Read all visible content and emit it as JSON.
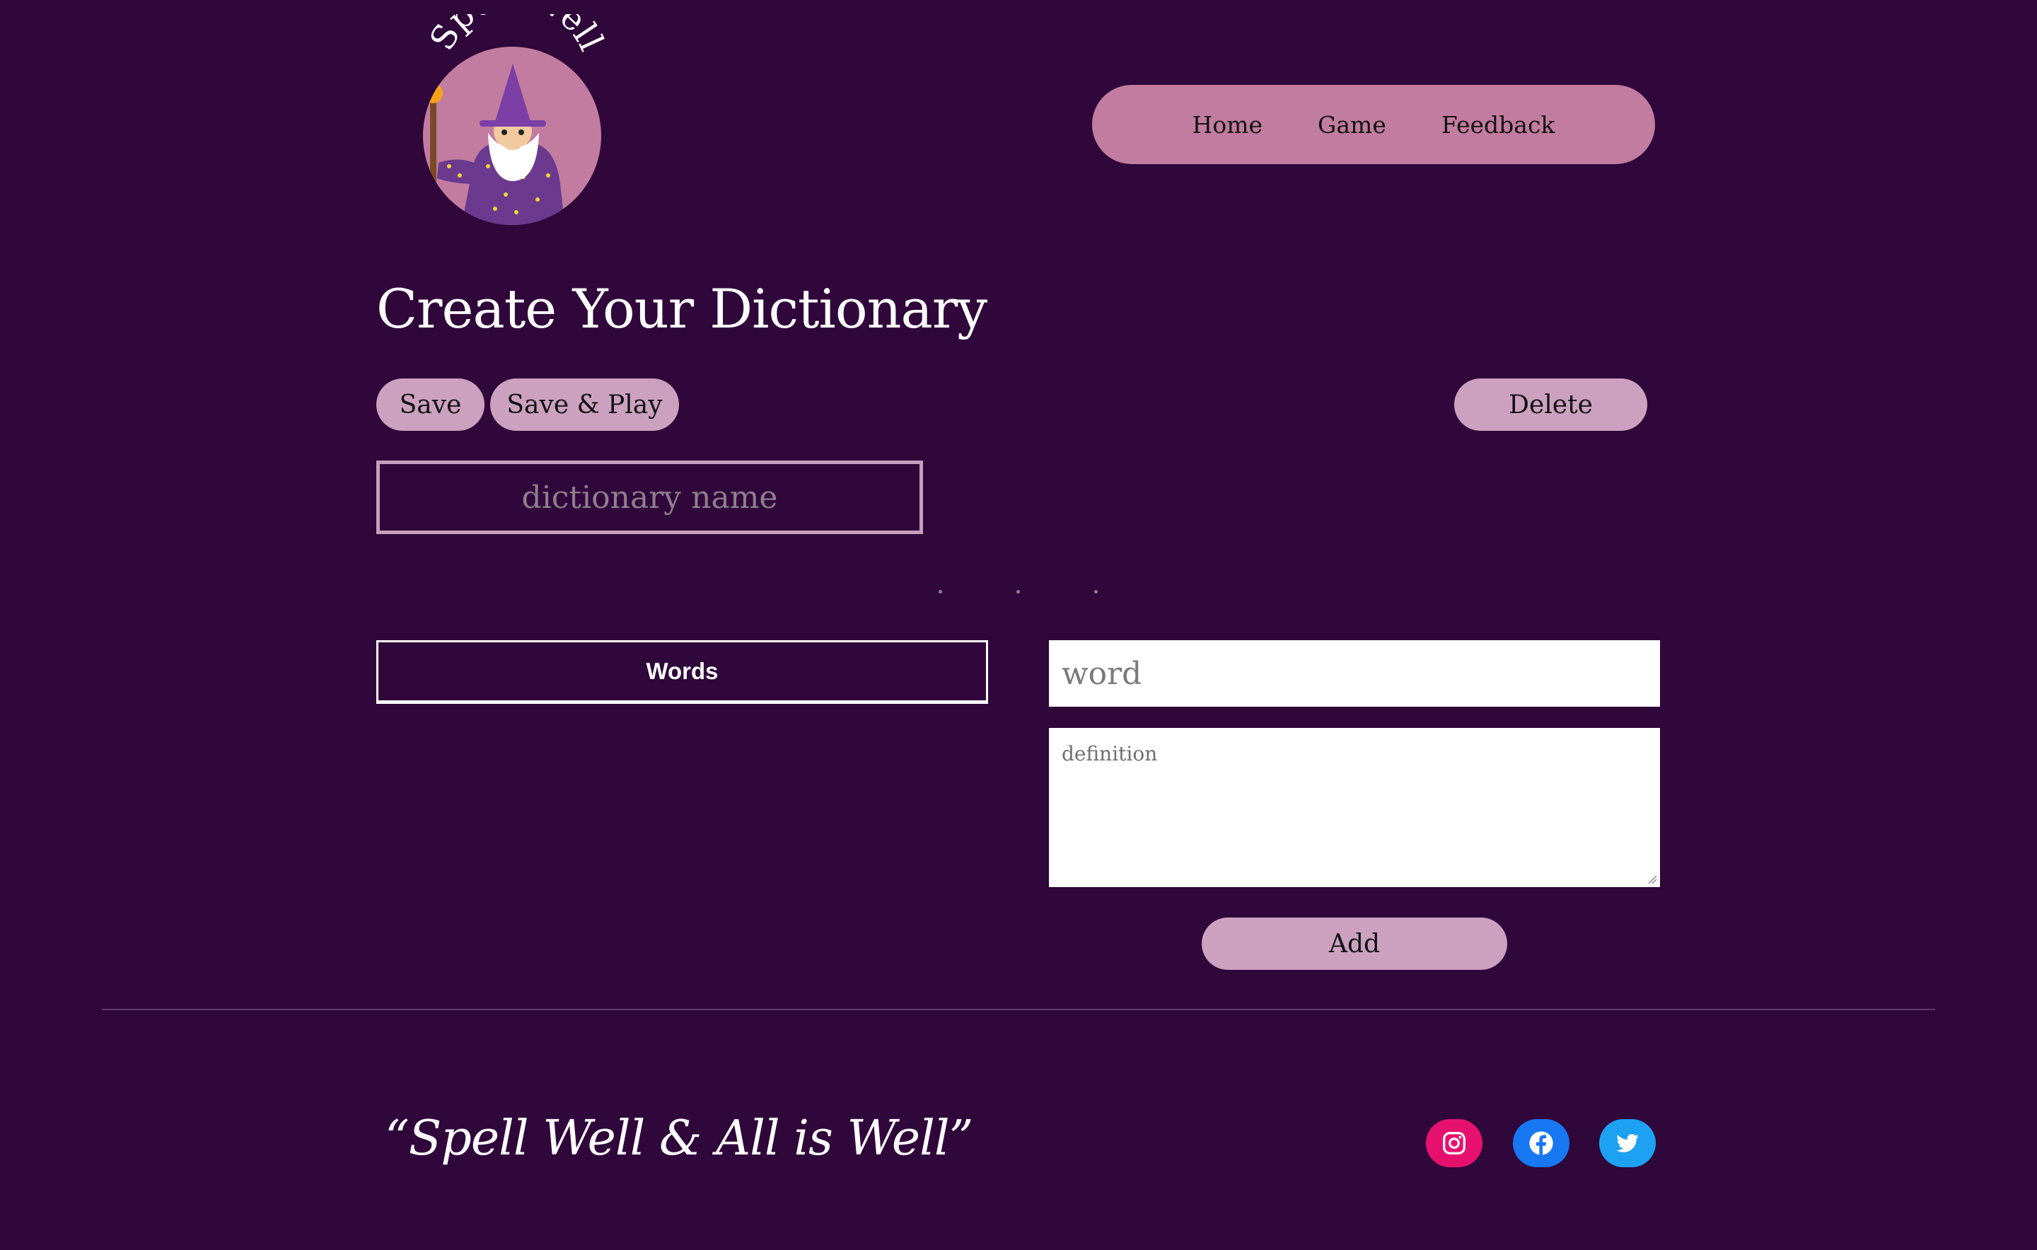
{
  "logo": {
    "text": "Spell Well"
  },
  "nav": {
    "items": [
      "Home",
      "Game",
      "Feedback"
    ]
  },
  "page": {
    "title": "Create Your Dictionary"
  },
  "toolbar": {
    "save_label": "Save",
    "save_play_label": "Save & Play",
    "delete_label": "Delete"
  },
  "dictionary": {
    "name_placeholder": "dictionary name"
  },
  "words_panel": {
    "header": "Words"
  },
  "entry": {
    "word_placeholder": "word",
    "definition_placeholder": "definition",
    "add_label": "Add"
  },
  "footer": {
    "tagline": "“Spell Well & All is Well”",
    "social": [
      "instagram-icon",
      "facebook-icon",
      "twitter-icon"
    ]
  },
  "colors": {
    "background": "#30073b",
    "nav": "#c27ca0",
    "button": "#cca1c0",
    "instagram": "#e6116e",
    "facebook": "#1877f2",
    "twitter": "#1da1f2"
  }
}
